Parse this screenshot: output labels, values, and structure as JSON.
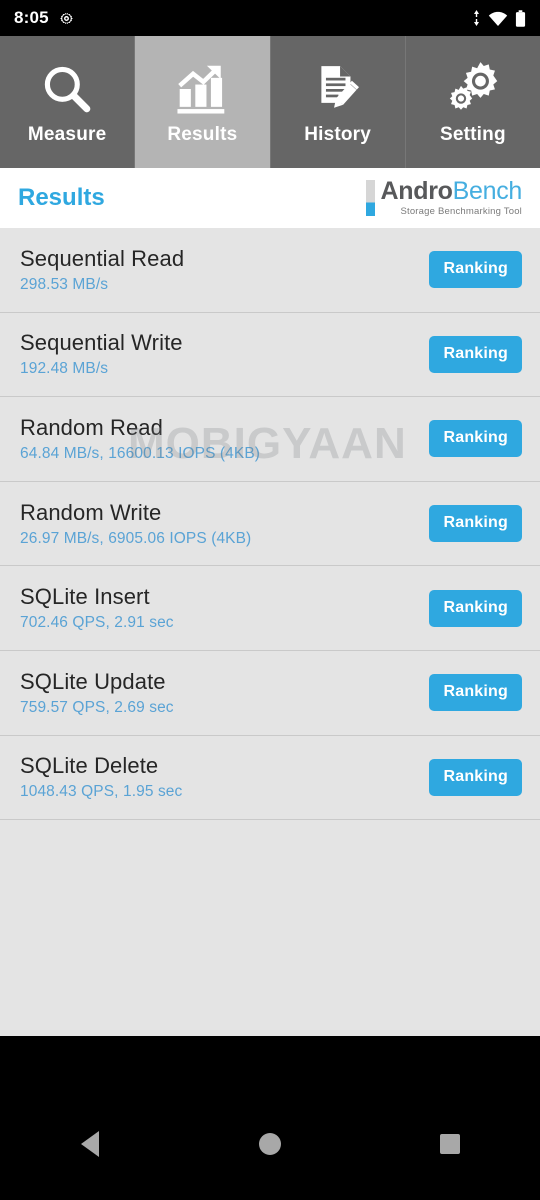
{
  "statusbar": {
    "time": "8:05",
    "icons": [
      "gear-icon",
      "data-transfer-icon",
      "wifi-icon",
      "battery-icon"
    ]
  },
  "tabs": [
    {
      "label": "Measure",
      "icon": "magnifier-icon",
      "active": false
    },
    {
      "label": "Results",
      "icon": "bar-chart-arrow-icon",
      "active": true
    },
    {
      "label": "History",
      "icon": "document-pencil-icon",
      "active": false
    },
    {
      "label": "Setting",
      "icon": "gears-icon",
      "active": false
    }
  ],
  "header": {
    "title": "Results",
    "logo": {
      "part1": "Andro",
      "part2": "Bench",
      "tagline": "Storage Benchmarking Tool"
    }
  },
  "results": {
    "button_label": "Ranking",
    "rows": [
      {
        "title": "Sequential Read",
        "value": "298.53 MB/s"
      },
      {
        "title": "Sequential Write",
        "value": "192.48 MB/s"
      },
      {
        "title": "Random Read",
        "value": "64.84 MB/s, 16600.13 IOPS (4KB)"
      },
      {
        "title": "Random Write",
        "value": "26.97 MB/s, 6905.06 IOPS (4KB)"
      },
      {
        "title": "SQLite Insert",
        "value": "702.46 QPS, 2.91 sec"
      },
      {
        "title": "SQLite Update",
        "value": "759.57 QPS, 2.69 sec"
      },
      {
        "title": "SQLite Delete",
        "value": "1048.43 QPS, 1.95 sec"
      }
    ]
  },
  "watermark": {
    "text": "MOBIGYAAN"
  },
  "navbar": {
    "back": "back-icon",
    "home": "home-icon",
    "recent": "recent-apps-icon"
  },
  "colors": {
    "accent_blue": "#2fa8e0",
    "value_blue": "#5aa3d5",
    "tab_bg": "#666666",
    "tab_active_bg": "#b4b4b4",
    "content_bg": "#e4e4e4"
  }
}
